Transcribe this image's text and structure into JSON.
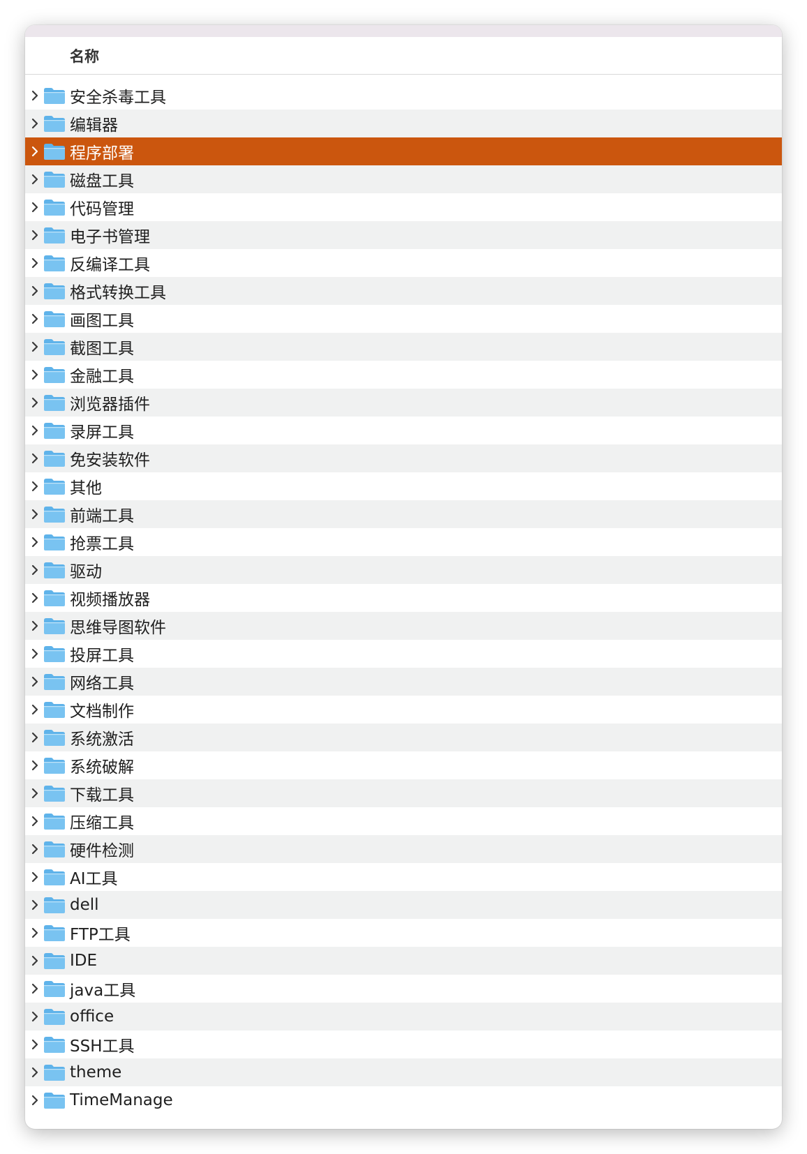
{
  "header": {
    "column_name": "名称"
  },
  "colors": {
    "selection": "#cb560e",
    "stripe": "#f0f1f1",
    "folder_top": "#5fb3ea",
    "folder_body": "#79c3f1"
  },
  "items": [
    {
      "label": "安全杀毒工具",
      "selected": false
    },
    {
      "label": "编辑器",
      "selected": false
    },
    {
      "label": "程序部署",
      "selected": true
    },
    {
      "label": "磁盘工具",
      "selected": false
    },
    {
      "label": "代码管理",
      "selected": false
    },
    {
      "label": "电子书管理",
      "selected": false
    },
    {
      "label": "反编译工具",
      "selected": false
    },
    {
      "label": "格式转换工具",
      "selected": false
    },
    {
      "label": "画图工具",
      "selected": false
    },
    {
      "label": "截图工具",
      "selected": false
    },
    {
      "label": "金融工具",
      "selected": false
    },
    {
      "label": "浏览器插件",
      "selected": false
    },
    {
      "label": "录屏工具",
      "selected": false
    },
    {
      "label": "免安装软件",
      "selected": false
    },
    {
      "label": "其他",
      "selected": false
    },
    {
      "label": "前端工具",
      "selected": false
    },
    {
      "label": "抢票工具",
      "selected": false
    },
    {
      "label": "驱动",
      "selected": false
    },
    {
      "label": "视频播放器",
      "selected": false
    },
    {
      "label": "思维导图软件",
      "selected": false
    },
    {
      "label": "投屏工具",
      "selected": false
    },
    {
      "label": "网络工具",
      "selected": false
    },
    {
      "label": "文档制作",
      "selected": false
    },
    {
      "label": "系统激活",
      "selected": false
    },
    {
      "label": "系统破解",
      "selected": false
    },
    {
      "label": "下载工具",
      "selected": false
    },
    {
      "label": "压缩工具",
      "selected": false
    },
    {
      "label": "硬件检测",
      "selected": false
    },
    {
      "label": "AI工具",
      "selected": false
    },
    {
      "label": "dell",
      "selected": false
    },
    {
      "label": "FTP工具",
      "selected": false
    },
    {
      "label": "IDE",
      "selected": false
    },
    {
      "label": "java工具",
      "selected": false
    },
    {
      "label": "office",
      "selected": false
    },
    {
      "label": "SSH工具",
      "selected": false
    },
    {
      "label": "theme",
      "selected": false
    },
    {
      "label": "TimeManage",
      "selected": false
    }
  ]
}
